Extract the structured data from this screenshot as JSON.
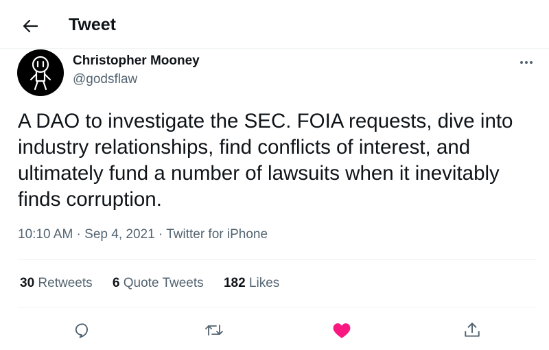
{
  "header": {
    "title": "Tweet",
    "back_icon": "arrow-left-icon"
  },
  "author": {
    "name": "Christopher Mooney",
    "handle": "@godsflaw"
  },
  "tweet": {
    "text": "A DAO to investigate the SEC.  FOIA requests, dive into\nindustry relationships, find conflicts of interest, and\nultimately fund a number of lawsuits when it inevitably\nfinds corruption.",
    "time": "10:10 AM",
    "date": "Sep 4, 2021",
    "source": "Twitter for iPhone"
  },
  "stats": {
    "retweets": {
      "count": "30",
      "label": "Retweets"
    },
    "quotes": {
      "count": "6",
      "label": "Quote Tweets"
    },
    "likes": {
      "count": "182",
      "label": "Likes"
    }
  },
  "actions": [
    "reply-icon",
    "retweet-icon",
    "like-icon",
    "share-icon"
  ],
  "colors": {
    "like": "#f91880",
    "text": "#0f1419",
    "secondary": "#536471",
    "divider": "#eff3f4"
  }
}
